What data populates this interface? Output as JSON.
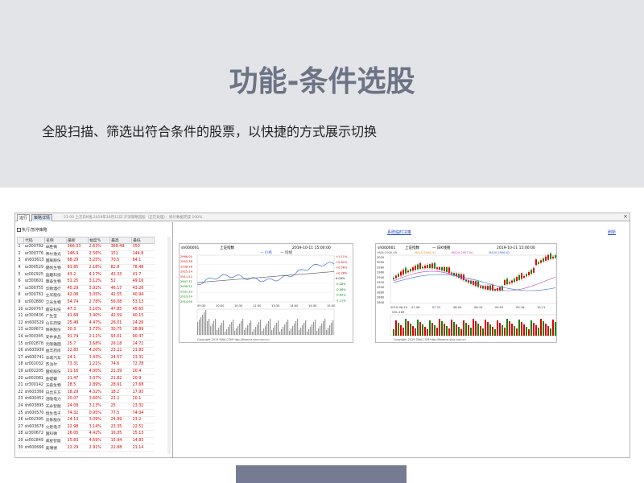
{
  "banner": {
    "title": "功能-条件选股",
    "subtitle": "全股扫描、筛选出符合条件的股票，以快捷的方式展示切换"
  },
  "window": {
    "tabs": [
      "运行",
      "策略详情"
    ],
    "status": "21:00  上次日K线:2019年10月11日 沪深策略选股（正在处理）：统计数据完成 100%",
    "close": "×",
    "checkbox_label": "执行/暂停策略",
    "columns": [
      "",
      "代码",
      "名称",
      "最新",
      "幅度%",
      "最高",
      "最低"
    ],
    "rows": [
      [
        "1",
        "sz300782",
        "卓胜微",
        "366.33",
        "2.63%",
        "368.49",
        "350"
      ],
      [
        "2",
        "sz300776",
        "帝尔激光",
        "146.9",
        "2.56%",
        "151",
        "144.8"
      ],
      [
        "3",
        "sh603613",
        "国联股份",
        "68.29",
        "3.25%",
        "70.5",
        "64.1"
      ],
      [
        "4",
        "sz300529",
        "健帆生物",
        "81.85",
        "2.18%",
        "82.8",
        "78.48"
      ],
      [
        "5",
        "sz002925",
        "盈趣科技",
        "43.2",
        "4.17%",
        "43.33",
        "41.7"
      ],
      [
        "6",
        "sz300601",
        "康泰生物",
        "51.25",
        "3.12%",
        "52",
        "49.16"
      ],
      [
        "7",
        "sz300755",
        "华致酒行",
        "45.29",
        "3.92%",
        "46.17",
        "43.26"
      ],
      [
        "8",
        "sz300761",
        "立华股份",
        "42.08",
        "3.05%",
        "42.55",
        "40.94"
      ],
      [
        "9",
        "sz002880",
        "卫光生物",
        "54.74",
        "2.78%",
        "56.08",
        "53.13"
      ],
      [
        "10",
        "sz300767",
        "震安科技",
        "47.3",
        "3.10%",
        "47.85",
        "45.65"
      ],
      [
        "11",
        "sz300436",
        "广生堂",
        "41.68",
        "3.40%",
        "42.59",
        "40.15"
      ],
      [
        "12",
        "sh600529",
        "山东药玻",
        "25.49",
        "4.47%",
        "26.01",
        "24.26"
      ],
      [
        "13",
        "sz300673",
        "佩蒂股份",
        "30.3",
        "3.73%",
        "30.75",
        "28.89"
      ],
      [
        "14",
        "sz300345",
        "安井食品",
        "91.74",
        "2.11%",
        "93.01",
        "90.47"
      ],
      [
        "15",
        "sz002878",
        "元隆雅图",
        "25.7",
        "3.68%",
        "26.18",
        "24.72"
      ],
      [
        "16",
        "sh603939",
        "益丰药房",
        "22.83",
        "4.20%",
        "23.22",
        "21.83"
      ],
      [
        "17",
        "sh600741",
        "华域汽车",
        "24.1",
        "3.43%",
        "24.57",
        "23.31"
      ],
      [
        "18",
        "sz002032",
        "苏泊尔",
        "73.31",
        "1.21%",
        "74.6",
        "72.78"
      ],
      [
        "19",
        "sz002205",
        "国统股份",
        "21.16",
        "4.00%",
        "21.39",
        "20.4"
      ],
      [
        "20",
        "sz002081",
        "金螳螂",
        "21.47",
        "3.07%",
        "21.82",
        "20.9"
      ],
      [
        "21",
        "sz300142",
        "沃森生物",
        "28.5",
        "2.89%",
        "28.91",
        "27.68"
      ],
      [
        "22",
        "sh603366",
        "日出东方",
        "18.29",
        "4.32%",
        "18.2",
        "17.93"
      ],
      [
        "23",
        "sh600452",
        "涪陵电力",
        "20.07",
        "3.60%",
        "21.2",
        "20.1"
      ],
      [
        "24",
        "sh603895",
        "天永智能",
        "24.08",
        "3.13%",
        "25",
        "23.32"
      ],
      [
        "25",
        "sh600570",
        "恒生电子",
        "74.32",
        "0.95%",
        "77.5",
        "74.04"
      ],
      [
        "26",
        "sz002395",
        "双象股份",
        "24.13",
        "3.09%",
        "24.89",
        "23.2"
      ],
      [
        "27",
        "sh603678",
        "火炬电子",
        "22.98",
        "3.14%",
        "23.35",
        "22.51"
      ],
      [
        "28",
        "sz300672",
        "国科微",
        "16.05",
        "4.42%",
        "16.35",
        "15.13"
      ],
      [
        "29",
        "sz002849",
        "威星智能",
        "15.83",
        "4.69%",
        "15.94",
        "14.83"
      ],
      [
        "30",
        "sh600666",
        "奥瑞德",
        "22.29",
        "2.91%",
        "22.88",
        "21.14"
      ]
    ],
    "link_left": "系统临时决策",
    "link_right": "刷新",
    "chart_left": {
      "code": "sh000001",
      "name": "上证指数",
      "date": "2019-10-11 15:00:00",
      "legend": [
        "价格",
        "均线"
      ],
      "left_ticks": [
        "2966.00",
        "2952.38",
        "2938.76",
        "2925.14",
        "2911.52",
        "2947.71",
        "2939.52",
        "2931.33",
        "2923.14",
        "2914.95"
      ],
      "right_ticks": [
        "+1.11%",
        "+0.82%",
        "+0.56%",
        "+0.28%",
        "0.00%",
        "-0.28%",
        "-0.56%",
        "-0.82%",
        "-1.11%"
      ],
      "time_ticks": [
        "09:30",
        "10:00",
        "10:30",
        "11:30",
        "13:30",
        "14:00",
        "14:30",
        "15:00"
      ],
      "copyright": "Copyright 2019 SINA.COM  http://finance.sina.com.cn"
    },
    "chart_right": {
      "code": "sh000001",
      "name": "上证指数",
      "period": "日K线图",
      "date": "2019-10-11 15:00:00",
      "ma": [
        "MA5:2935.99",
        "MA10:2944.41",
        "MA20:2957.54",
        "MA30:2966.62"
      ],
      "left_ticks": [
        "3020",
        "3000",
        "2980",
        "2960",
        "2940",
        "2920",
        "2900",
        "2880",
        "2860",
        "2840"
      ],
      "date_ticks": [
        "2019-06-24",
        "07-08",
        "07-22",
        "08-05",
        "08-19",
        "09-02",
        "09-16",
        "10-11"
      ],
      "vol": "VOL:169",
      "copyright": "Copyright 2019 SINA.COM  http://finance.sina.com.cn"
    }
  }
}
